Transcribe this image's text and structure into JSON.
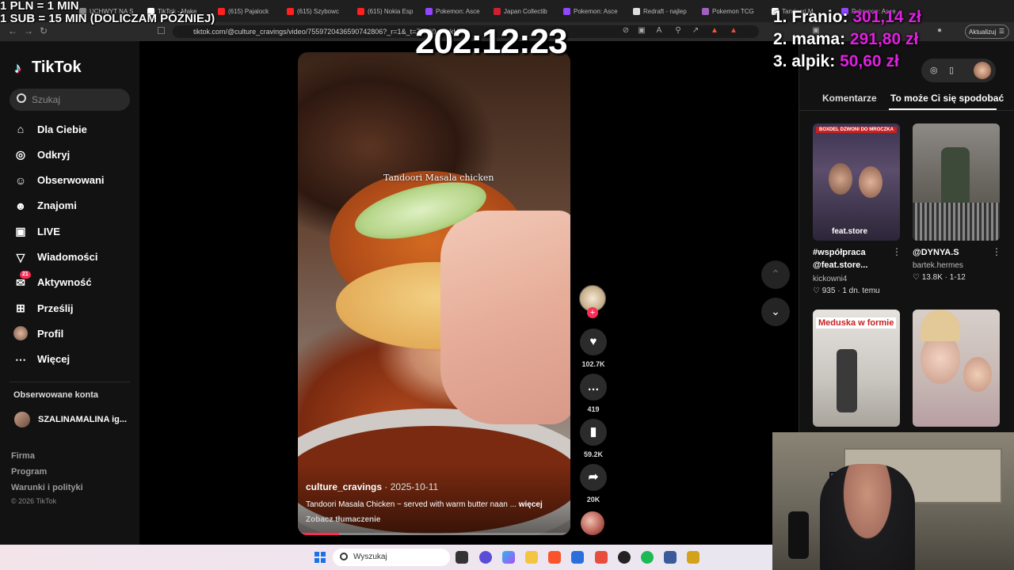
{
  "overlay": {
    "donate_line1": "1 PLN = 1 MIN",
    "donate_line2": "1 SUB = 15 MIN (DOLICZAM PÓŹNIEJ)",
    "timer": "202:12:23",
    "leaderboard": [
      {
        "rank": "1.",
        "name": "Franio:",
        "amount": "301,14 zł"
      },
      {
        "rank": "2.",
        "name": "mama:",
        "amount": "291,80 zł"
      },
      {
        "rank": "3.",
        "name": "alpik:",
        "amount": "50,60 zł"
      }
    ],
    "amount_color": "#e020e0"
  },
  "browser": {
    "tabs": [
      {
        "label": "UCHWYT NA S",
        "icon": "page-icon",
        "color": "#888888"
      },
      {
        "label": "TikTok - Make",
        "icon": "tiktok-icon",
        "color": "#ffffff"
      },
      {
        "label": "(615) Pajalock",
        "icon": "youtube-icon",
        "color": "#ff2020"
      },
      {
        "label": "(615) Szybowc",
        "icon": "youtube-icon",
        "color": "#ff2020"
      },
      {
        "label": "(615) Nokia Esp",
        "icon": "youtube-icon",
        "color": "#ff2020"
      },
      {
        "label": "Pokemon: Asce",
        "icon": "twitch-icon",
        "color": "#9146ff"
      },
      {
        "label": "Japan Collectib",
        "icon": "page-icon",
        "color": "#d02030"
      },
      {
        "label": "Pokemon: Asce",
        "icon": "twitch-icon",
        "color": "#9146ff"
      },
      {
        "label": "Redraft - najlep",
        "icon": "page-icon",
        "color": "#dddddd"
      },
      {
        "label": "Pokemon TCG",
        "icon": "page-icon",
        "color": "#a060c0"
      },
      {
        "label": "Tandoori M",
        "icon": "tiktok-icon",
        "color": "#ffffff"
      },
      {
        "label": "Pokemon: Asce",
        "icon": "twitch-icon",
        "color": "#9146ff"
      }
    ],
    "url": "tiktok.com/@culture_cravings/video/7559720436590742806?_r=1&_t=ZN-90...7bkHK",
    "update_label": "Aktualizuj"
  },
  "sidebar": {
    "brand": "TikTok",
    "search_placeholder": "Szukaj",
    "items": [
      {
        "label": "Dla Ciebie",
        "icon": "home-icon"
      },
      {
        "label": "Odkryj",
        "icon": "compass-icon"
      },
      {
        "label": "Obserwowani",
        "icon": "following-icon"
      },
      {
        "label": "Znajomi",
        "icon": "friends-icon"
      },
      {
        "label": "LIVE",
        "icon": "live-icon"
      },
      {
        "label": "Wiadomości",
        "icon": "messages-icon"
      },
      {
        "label": "Aktywność",
        "icon": "activity-icon",
        "badge": "21"
      },
      {
        "label": "Prześlij",
        "icon": "upload-icon"
      },
      {
        "label": "Profil",
        "icon": "profile-avatar"
      },
      {
        "label": "Więcej",
        "icon": "more-icon"
      }
    ],
    "followed_title": "Obserwowane konta",
    "followed_account": "SZALINAMALINA ig...",
    "footer": [
      "Firma",
      "Program",
      "Warunki i polityki"
    ],
    "copyright": "© 2026 TikTok"
  },
  "video": {
    "overlay_text": "Tandoori Masala chicken",
    "author": "culture_cravings",
    "date": "· 2025-10-11",
    "description": "Tandoori Masala Chicken ~ served with warm butter naan ...",
    "more": "więcej",
    "translate": "Zobacz tłumaczenie",
    "progress": 0.15,
    "accent": "#fe2c55"
  },
  "actions": {
    "likes": "102.7K",
    "comments": "419",
    "saves": "59.2K",
    "shares": "20K"
  },
  "panel": {
    "tabs": [
      "Komentarze",
      "To może Ci się spodobać"
    ],
    "active_tab": 1,
    "recommendations": [
      {
        "title_line1": "#współpraca",
        "title_line2": "@feat.store...",
        "author": "kickowni4",
        "likes": "935",
        "meta": "1 dn. temu",
        "thumb_caption": "feat.store",
        "thumb_top": "BOXDEL DZWONI DO MROCZKA"
      },
      {
        "title_line1": "@DYNYA.S",
        "title_line2": "",
        "author": "bartek.hermes",
        "likes": "13.8K",
        "meta": "1-12",
        "thumb_caption": "",
        "thumb_top": ""
      },
      {
        "title_line1": "",
        "title_line2": "",
        "author": "",
        "likes": "",
        "meta": "",
        "thumb_caption": "Meduska w formie",
        "thumb_top": ""
      },
      {
        "title_line1": "",
        "title_line2": "",
        "author": "",
        "likes": "",
        "meta": "",
        "thumb_caption": "",
        "thumb_top": ""
      }
    ]
  },
  "taskbar": {
    "search_placeholder": "Wyszukaj"
  }
}
